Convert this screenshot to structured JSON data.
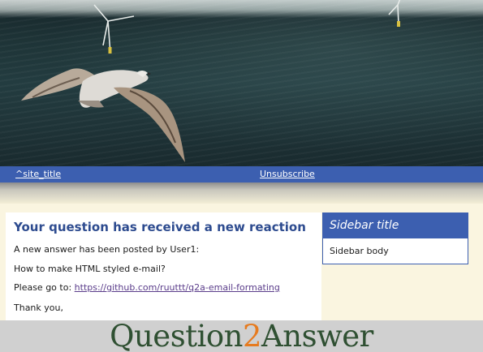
{
  "header": {
    "image_alt": "seagull flying over sea with wind turbines"
  },
  "navbar": {
    "site_title_link": "^site_title",
    "unsubscribe_link": "Unsubscribe"
  },
  "message": {
    "heading": "Your question has received a new reaction",
    "line1": "A new answer has been posted by User1:",
    "line2": "How to make HTML styled e-mail?",
    "line3_prefix": "Please go to: ",
    "line3_link": "https://github.com/ruuttt/q2a-email-formating",
    "line4": "Thank you,"
  },
  "sidebar": {
    "title": "Sidebar title",
    "body": "Sidebar body"
  },
  "footer": {
    "logo_part1": "Question",
    "logo_part2": "2",
    "logo_part3": "Answer"
  },
  "colors": {
    "nav_blue": "#3c5fb0",
    "heading_blue": "#2d4b8f",
    "logo_green": "#2f5032",
    "logo_orange": "#e67b1f",
    "page_cream": "#faf5e0"
  }
}
